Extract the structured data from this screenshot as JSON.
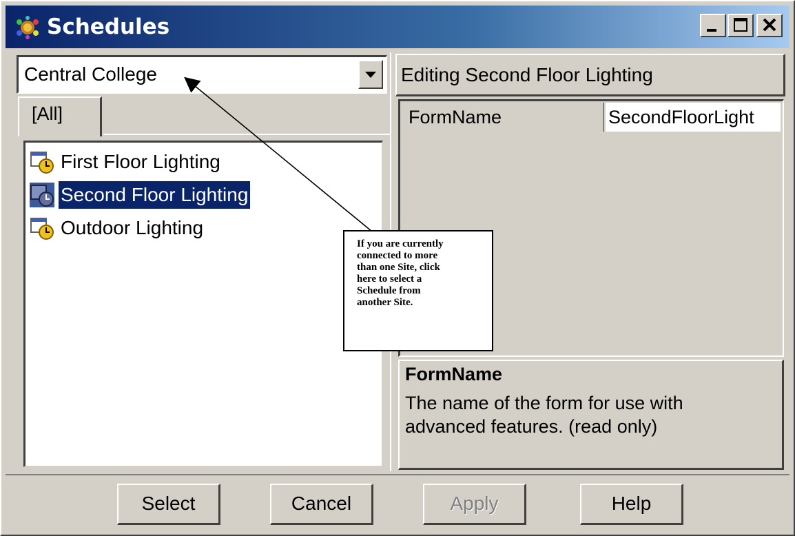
{
  "window": {
    "title": "Schedules",
    "title_icon": "schedules-app-icon",
    "controls": [
      "minimize-icon",
      "maximize-icon",
      "close-icon"
    ]
  },
  "site_selector": {
    "value": "Central College",
    "dropdown_icon": "chevron-down-icon"
  },
  "tabs": [
    {
      "label": "[All]",
      "selected": true
    }
  ],
  "schedule_list": {
    "items": [
      {
        "label": "First Floor Lighting",
        "icon": "schedule-clock-icon",
        "selected": false
      },
      {
        "label": "Second Floor Lighting",
        "icon": "schedule-clock-icon",
        "selected": true
      },
      {
        "label": "Outdoor Lighting",
        "icon": "schedule-clock-icon",
        "selected": false
      }
    ]
  },
  "editor": {
    "header": "Editing Second Floor Lighting",
    "properties": [
      {
        "name": "FormName",
        "value": "SecondFloorLight"
      }
    ],
    "description": {
      "title": "FormName",
      "text": "The name of the form for use with advanced features. (read only)"
    }
  },
  "buttons": {
    "select": "Select",
    "cancel": "Cancel",
    "apply": "Apply",
    "apply_enabled": false,
    "help": "Help"
  },
  "callout": {
    "lines": [
      "If you are currently",
      "connected to more",
      "than one Site, click",
      "here to select a",
      "Schedule from",
      "another Site."
    ]
  },
  "colors": {
    "titlebar_start": "#0a246a",
    "titlebar_end": "#a6caf0",
    "face": "#d4d0c8",
    "selection": "#0a246a"
  }
}
